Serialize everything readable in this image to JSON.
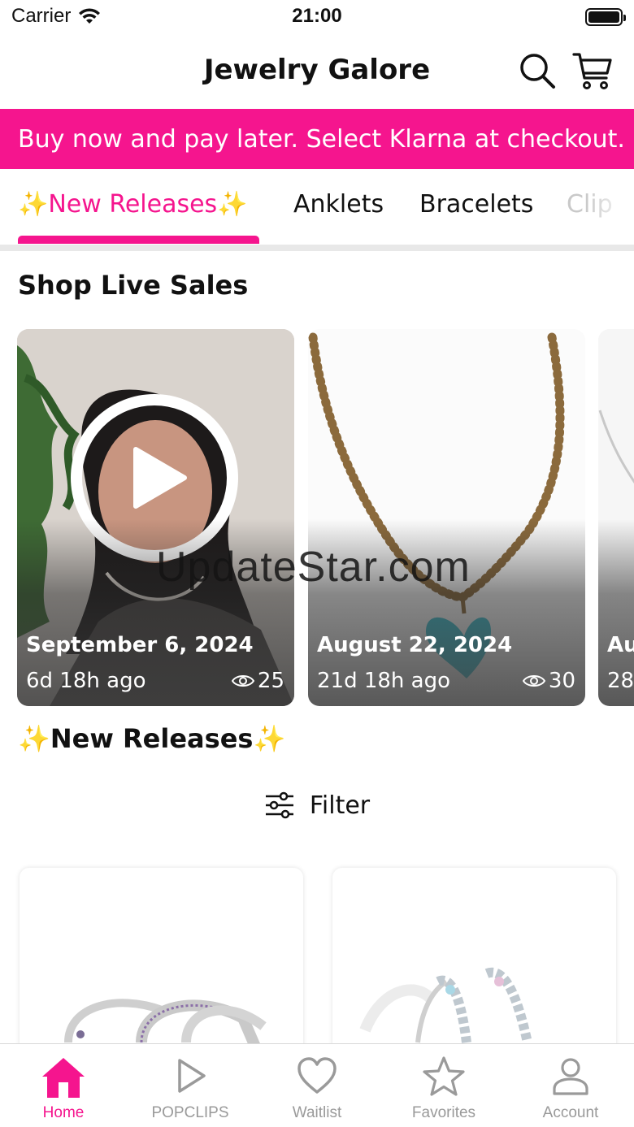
{
  "status_bar": {
    "carrier": "Carrier",
    "time": "21:00"
  },
  "header": {
    "title": "Jewelry Galore"
  },
  "promo": {
    "text": "Buy now and pay later.  Select Klarna at checkout."
  },
  "categories": [
    {
      "label": "✨New Releases✨",
      "active": true
    },
    {
      "label": "Anklets"
    },
    {
      "label": "Bracelets"
    },
    {
      "label": "Clip"
    }
  ],
  "live_sales": {
    "title": "Shop Live Sales",
    "cards": [
      {
        "date": "September 6, 2024",
        "ago": "6d 18h ago",
        "views": "25"
      },
      {
        "date": "August 22, 2024",
        "ago": "21d 18h ago",
        "views": "30"
      },
      {
        "date": "Au",
        "ago": "28"
      }
    ]
  },
  "watermark": "UpdateStar.com",
  "new_releases": {
    "title": "✨New Releases✨",
    "filter_label": "Filter"
  },
  "tabbar": {
    "items": [
      {
        "label": "Home",
        "icon": "home-icon",
        "active": true
      },
      {
        "label": "POPCLIPS",
        "icon": "play-icon"
      },
      {
        "label": "Waitlist",
        "icon": "heart-icon"
      },
      {
        "label": "Favorites",
        "icon": "star-icon"
      },
      {
        "label": "Account",
        "icon": "person-icon"
      }
    ]
  },
  "colors": {
    "accent": "#f5158e",
    "inactive": "#9a9a9a"
  }
}
